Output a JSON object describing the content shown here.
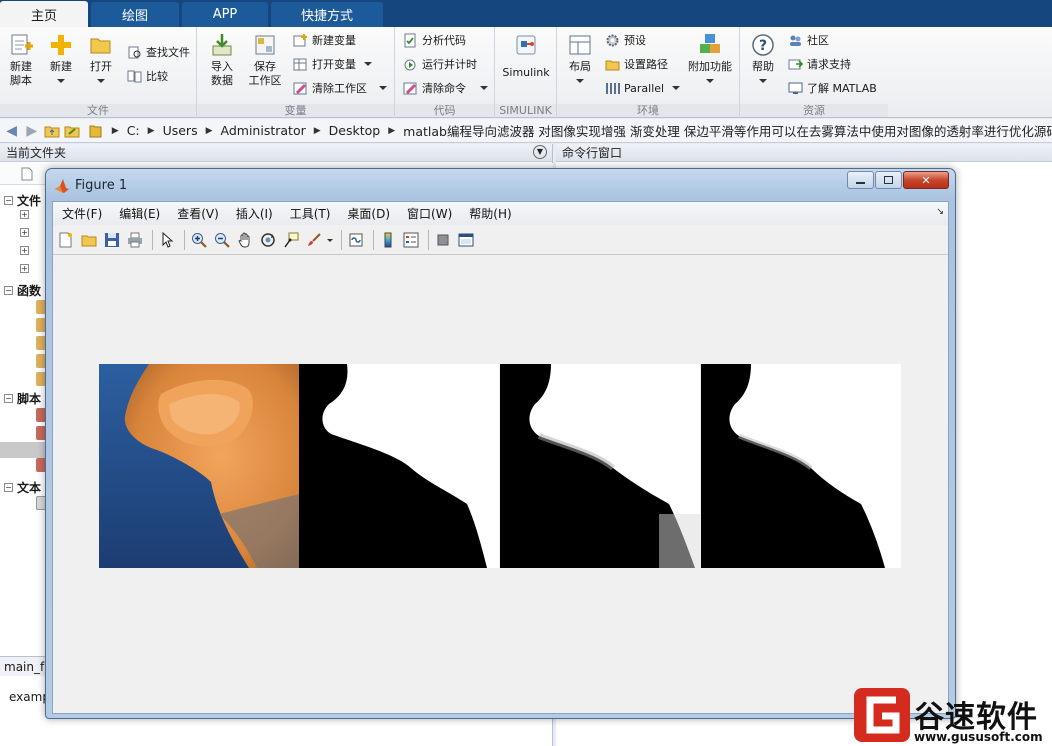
{
  "ribbon_tabs": [
    "主页",
    "绘图",
    "APP",
    "快捷方式"
  ],
  "ribbon": {
    "file": {
      "label": "文件",
      "new_script": [
        "新建",
        "脚本"
      ],
      "new": "新建",
      "open": "打开",
      "find_files": "查找文件",
      "compare": "比较"
    },
    "variable": {
      "label": "变量",
      "import": [
        "导入",
        "数据"
      ],
      "save": [
        "保存",
        "工作区"
      ],
      "new_var": "新建变量",
      "open_var": "打开变量",
      "clear_ws": "清除工作区"
    },
    "code": {
      "label": "代码",
      "analyze": "分析代码",
      "run_time": "运行并计时",
      "clear_cmd": "清除命令"
    },
    "simulink": {
      "label": "SIMULINK",
      "btn": "Simulink"
    },
    "env": {
      "label": "环境",
      "layout": "布局",
      "prefs": "预设",
      "set_path": "设置路径",
      "parallel": "Parallel",
      "addons": "附加功能"
    },
    "resources": {
      "label": "资源",
      "help": "帮助",
      "community": "社区",
      "support": "请求支持",
      "learn": "了解 MATLAB"
    }
  },
  "address": [
    "C:",
    "Users",
    "Administrator",
    "Desktop",
    "matlab编程导向滤波器 对图像实现增强 渐变处理 保边平滑等作用可以在去雾算法中使用对图像的透射率进行优化源码程序"
  ],
  "left_pane": {
    "title": "当前文件夹",
    "sections": [
      "文件",
      "函数",
      "脚本",
      "文本"
    ],
    "bottom_tab": "main_fe",
    "bottom_text": "examp"
  },
  "right_pane": {
    "title": "命令行窗口"
  },
  "figure": {
    "title": "Figure 1",
    "menus": [
      "文件(F)",
      "编辑(E)",
      "查看(V)",
      "插入(I)",
      "工具(T)",
      "桌面(D)",
      "窗口(W)",
      "帮助(H)"
    ],
    "toolbar_icons": [
      "new-figure-icon",
      "open-icon",
      "save-icon",
      "print-icon",
      "pointer-icon",
      "zoom-in-icon",
      "zoom-out-icon",
      "pan-icon",
      "rotate-icon",
      "data-cursor-icon",
      "brush-icon",
      "link-icon",
      "colorbar-icon",
      "legend-icon",
      "hide-plot-tools-icon",
      "show-plot-tools-icon"
    ],
    "panels": [
      "original-image",
      "binary-mask",
      "guided-filter-output-1",
      "guided-filter-output-2"
    ]
  },
  "watermark": {
    "brand": "谷速软件",
    "url": "www.gususoft.com"
  },
  "colors": {
    "tab_blue": "#15477e",
    "figure_frame": "#a9c3e0",
    "close_red": "#c8452a"
  }
}
